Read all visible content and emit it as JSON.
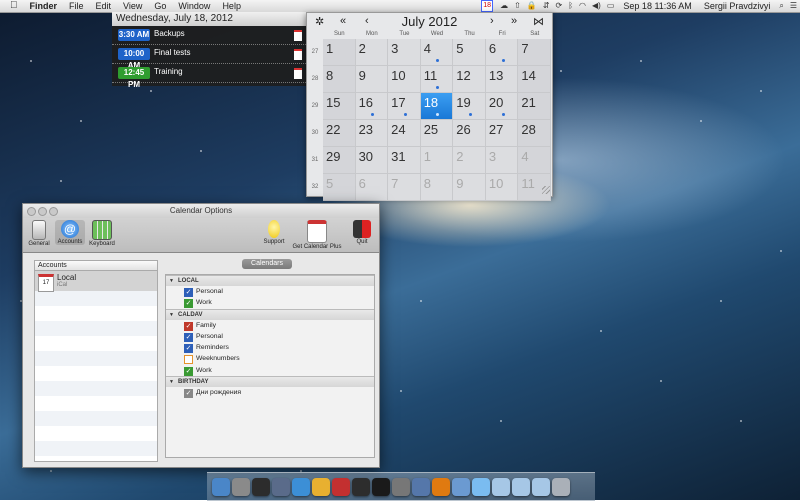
{
  "menubar": {
    "apple_icon": "apple-icon",
    "items": [
      "Finder",
      "File",
      "Edit",
      "View",
      "Go",
      "Window",
      "Help"
    ],
    "status_cal_day": "18",
    "date_time": "Sep 18  11:36 AM",
    "user": "Sergii Pravdzivyi"
  },
  "agenda": {
    "header": "Wednesday, July 18, 2012",
    "events": [
      {
        "time": "3:30 AM",
        "title": "Backups",
        "color": "#1f63c9"
      },
      {
        "time": "10:00 AM",
        "title": "Final tests",
        "color": "#1f63c9"
      },
      {
        "time": "12:45 PM",
        "title": "Training",
        "color": "#2f9d2f"
      }
    ]
  },
  "calendar": {
    "month_label": "July 2012",
    "weekdays": [
      "Sun",
      "Mon",
      "Tue",
      "Wed",
      "Thu",
      "Fri",
      "Sat"
    ],
    "week_numbers": [
      "27",
      "28",
      "29",
      "30",
      "31",
      "32"
    ],
    "days": [
      {
        "d": "1"
      },
      {
        "d": "2"
      },
      {
        "d": "3"
      },
      {
        "d": "4",
        "dot": true
      },
      {
        "d": "5"
      },
      {
        "d": "6",
        "dot": true
      },
      {
        "d": "7"
      },
      {
        "d": "8"
      },
      {
        "d": "9"
      },
      {
        "d": "10"
      },
      {
        "d": "11",
        "dot": true
      },
      {
        "d": "12"
      },
      {
        "d": "13"
      },
      {
        "d": "14"
      },
      {
        "d": "15"
      },
      {
        "d": "16",
        "dot": true
      },
      {
        "d": "17",
        "dot": true
      },
      {
        "d": "18",
        "today": true,
        "dot": true
      },
      {
        "d": "19",
        "dot": true
      },
      {
        "d": "20",
        "dot": true
      },
      {
        "d": "21"
      },
      {
        "d": "22"
      },
      {
        "d": "23"
      },
      {
        "d": "24"
      },
      {
        "d": "25"
      },
      {
        "d": "26"
      },
      {
        "d": "27"
      },
      {
        "d": "28"
      },
      {
        "d": "29"
      },
      {
        "d": "30"
      },
      {
        "d": "31"
      },
      {
        "d": "1",
        "other": true
      },
      {
        "d": "2",
        "other": true
      },
      {
        "d": "3",
        "other": true
      },
      {
        "d": "4",
        "other": true
      },
      {
        "d": "5",
        "other": true
      },
      {
        "d": "6",
        "other": true
      },
      {
        "d": "7",
        "other": true
      },
      {
        "d": "8",
        "other": true
      },
      {
        "d": "9",
        "other": true
      },
      {
        "d": "10",
        "other": true
      },
      {
        "d": "11",
        "other": true
      }
    ]
  },
  "options_window": {
    "title": "Calendar Options",
    "toolbar": {
      "general": "General",
      "accounts": "Accounts",
      "keyboard": "Keyboard",
      "support": "Support",
      "get_plus": "Get Calendar Plus",
      "quit": "Quit"
    },
    "accounts_header": "Accounts",
    "account": {
      "name": "Local",
      "sub": "iCal",
      "icon_day": "17"
    },
    "segment_label": "Calendars",
    "groups": [
      {
        "name": "LOCAL",
        "items": [
          {
            "label": "Personal",
            "color": "#2d5fb8"
          },
          {
            "label": "Work",
            "color": "#3a9a33"
          }
        ]
      },
      {
        "name": "CALDAV",
        "items": [
          {
            "label": "Family",
            "color": "#c0392b"
          },
          {
            "label": "Personal",
            "color": "#2d5fb8"
          },
          {
            "label": "Reminders",
            "color": "#2d5fb8"
          },
          {
            "label": "Weeknumbers",
            "color": "#e6932c",
            "unchecked": true
          },
          {
            "label": "Work",
            "color": "#3a9a33"
          }
        ]
      },
      {
        "name": "BIRTHDAY",
        "items": [
          {
            "label": "Дни рождения",
            "color": "#888888"
          }
        ]
      }
    ]
  },
  "dock": {
    "icons": [
      "finder-icon",
      "launchpad-icon",
      "dashboard-icon",
      "mission-control-icon",
      "safari-icon",
      "chrome-icon",
      "calendar-icon",
      "activity-monitor-icon",
      "terminal-icon",
      "system-preferences-icon",
      "vmware-icon",
      "vlc-icon",
      "xcode-icon",
      "messages-icon",
      "folder-icon",
      "downloads-icon",
      "documents-icon",
      "trash-icon"
    ],
    "colors": [
      "#4a86c8",
      "#8a8a8a",
      "#2c2c2c",
      "#5a6b8a",
      "#3c8fd6",
      "#e8b030",
      "#c33030",
      "#2d2d2d",
      "#1a1a1a",
      "#777777",
      "#5577aa",
      "#e07a10",
      "#6b9ad1",
      "#7abcf0",
      "#a6c7e6",
      "#a6c7e6",
      "#a6c7e6",
      "#aab0b8"
    ]
  }
}
